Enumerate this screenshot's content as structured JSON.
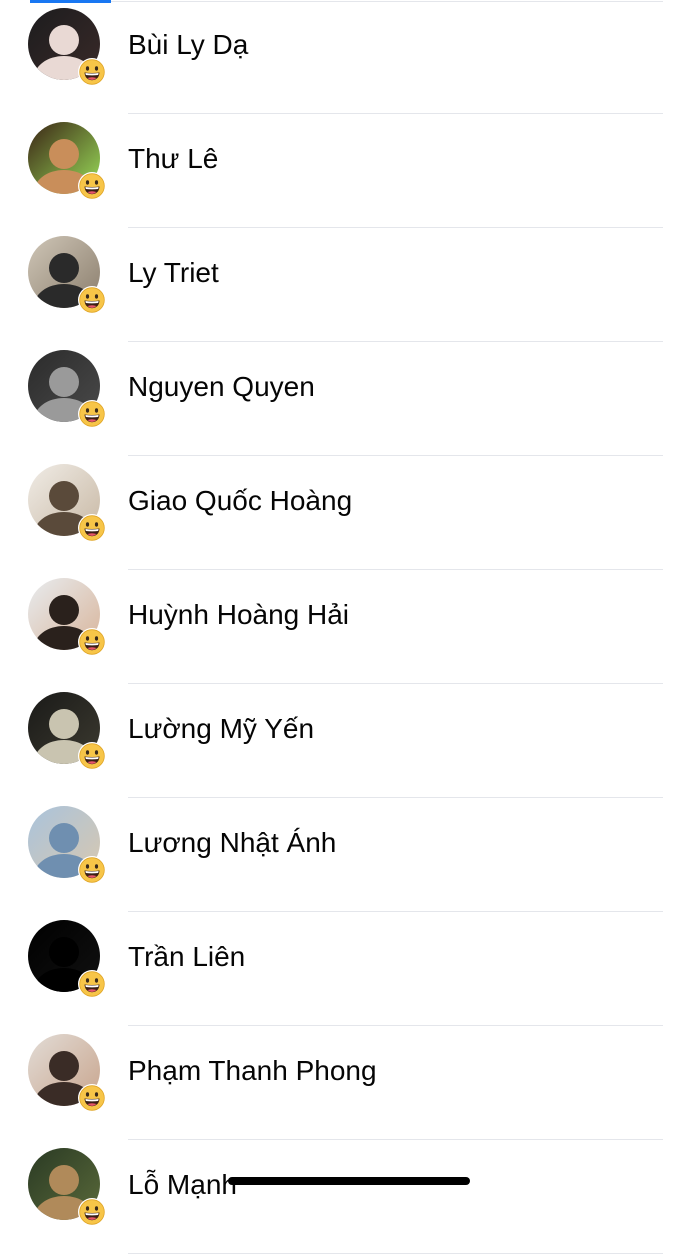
{
  "friends": [
    {
      "name": "Bùi Ly Dạ",
      "avatar_colors": [
        "#1c1c1e",
        "#e9d9d4",
        "#3a2a28"
      ],
      "reaction": "grinning-face-icon"
    },
    {
      "name": "Thư Lê",
      "avatar_colors": [
        "#3b2415",
        "#c98e5a",
        "#9be05a"
      ],
      "reaction": "grinning-face-icon"
    },
    {
      "name": "Ly Triet",
      "avatar_colors": [
        "#cfc6b7",
        "#2a2a2a",
        "#8a7d6c"
      ],
      "reaction": "grinning-face-icon"
    },
    {
      "name": "Nguyen Quyen",
      "avatar_colors": [
        "#2b2b2b",
        "#9a9a9a",
        "#4a4a4a"
      ],
      "reaction": "grinning-face-icon"
    },
    {
      "name": "Giao Quốc Hoàng",
      "avatar_colors": [
        "#f0ece6",
        "#5a4a3a",
        "#c8b8a4"
      ],
      "reaction": "grinning-face-icon"
    },
    {
      "name": "Huỳnh Hoàng Hải",
      "avatar_colors": [
        "#e8ecef",
        "#2a211c",
        "#d8b49a"
      ],
      "reaction": "grinning-face-icon"
    },
    {
      "name": "Lường Mỹ Yến",
      "avatar_colors": [
        "#1a1a18",
        "#c9c4b0",
        "#3c3a30"
      ],
      "reaction": "grinning-face-icon"
    },
    {
      "name": "Lương Nhật Ánh",
      "avatar_colors": [
        "#a9c3dc",
        "#6f8fb0",
        "#d8c8b0"
      ],
      "reaction": "grinning-face-icon"
    },
    {
      "name": "Trần Liên",
      "avatar_colors": [
        "#000000",
        "#000000",
        "#111111"
      ],
      "reaction": "grinning-face-icon"
    },
    {
      "name": "Phạm Thanh Phong",
      "avatar_colors": [
        "#e2dcd6",
        "#3a2c26",
        "#c8a48c"
      ],
      "reaction": "grinning-face-icon"
    },
    {
      "name": "Lỗ Mạnh",
      "avatar_colors": [
        "#2a3a24",
        "#b08a5a",
        "#5a6a3a"
      ],
      "reaction": "grinning-face-icon"
    }
  ],
  "colors": {
    "accent": "#1877f2",
    "divider": "#e4e6eb",
    "text": "#050505",
    "emoji_face": "#f7c548",
    "emoji_outline": "#e0a526"
  }
}
